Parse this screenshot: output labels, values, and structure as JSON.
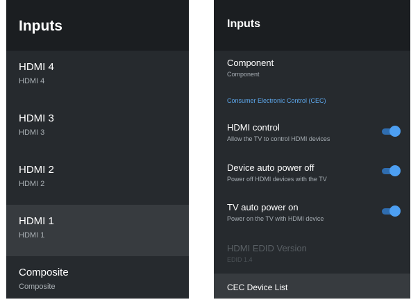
{
  "left": {
    "title": "Inputs",
    "items": [
      {
        "label": "HDMI 4",
        "sub": "HDMI 4"
      },
      {
        "label": "HDMI 3",
        "sub": "HDMI 3"
      },
      {
        "label": "HDMI 2",
        "sub": "HDMI 2"
      },
      {
        "label": "HDMI 1",
        "sub": "HDMI 1",
        "selected": true
      },
      {
        "label": "Composite",
        "sub": "Composite"
      }
    ]
  },
  "right": {
    "title": "Inputs",
    "component": {
      "label": "Component",
      "sub": "Component"
    },
    "cec_section": "Consumer Electronic Control (CEC)",
    "settings": [
      {
        "label": "HDMI control",
        "sub": "Allow the TV to control HDMI devices",
        "enabled": true
      },
      {
        "label": "Device auto power off",
        "sub": "Power off HDMI devices with the TV",
        "enabled": true
      },
      {
        "label": "TV auto power on",
        "sub": "Power on the TV with HDMI device",
        "enabled": true
      }
    ],
    "edid": {
      "label": "HDMI EDID Version",
      "sub": "EDID 1.4"
    },
    "cec_list": "CEC Device List"
  },
  "colors": {
    "accent": "#4d9ff2",
    "section_label": "#5eaaf0",
    "panel_bg": "#262a2e",
    "header_bg": "#1b1e21"
  }
}
